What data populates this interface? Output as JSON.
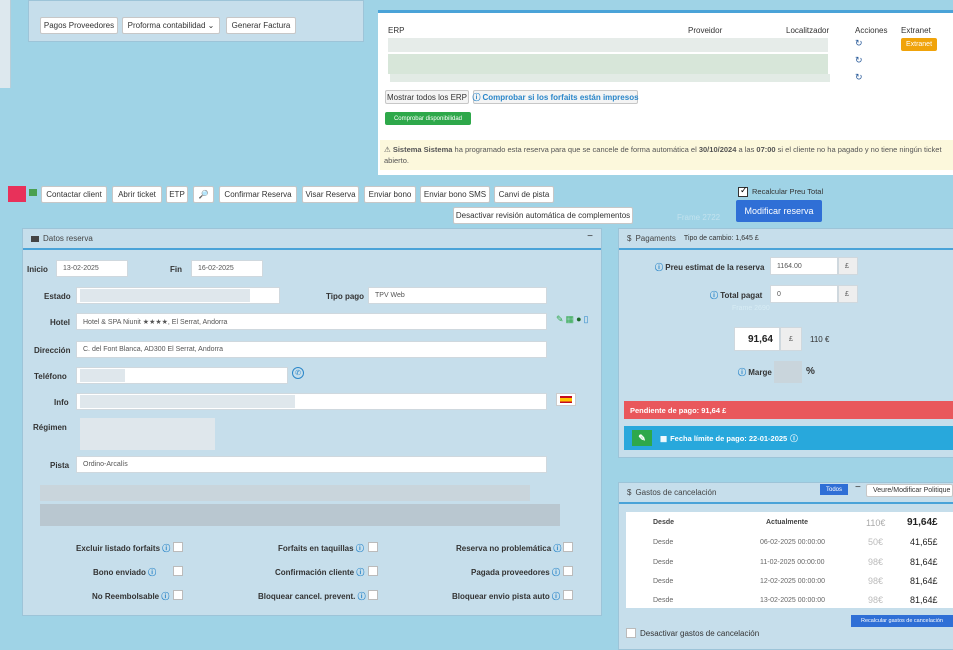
{
  "top_buttons": {
    "pagos_proveedores": "Pagos Proveedores",
    "proforma": "Proforma contabilidad ⌄",
    "generar_factura": "Generar Factura"
  },
  "erp_table": {
    "headers": {
      "erp": "ERP",
      "proveidor": "Proveidor",
      "localitzador": "Localitzador",
      "acciones": "Acciones",
      "extranet": "Extranet"
    },
    "extranet_badge": "Extranet",
    "refresh_glyph": "↻"
  },
  "erp_buttons": {
    "mostrar": "Mostrar todos los ERP",
    "comprobar_forfaits": "Comprobar si los forfaits están impresos",
    "comprobar_disp": "Comprobar disponibilidad"
  },
  "warning": {
    "icon": "⚠",
    "prefix": "Sistema Sistema",
    "t1": " ha programado esta reserva para que se cancele de forma automática el ",
    "date": "30/10/2024",
    "t2": " a las ",
    "time": "07:00",
    "t3": " si el cliente no ha pagado y no tiene ningún ticket abierto."
  },
  "recalcular": "Recalcular Preu Total",
  "modificar": "Modificar reserva",
  "actions": [
    "Contactar client",
    "Abrir ticket",
    "ETP",
    "🔎",
    "Confirmar Reserva",
    "Visar Reserva",
    "Enviar bono",
    "Enviar bono SMS",
    "Canvi de pista"
  ],
  "desactivar_revision": "Desactivar revisión automática de complementos",
  "datos": {
    "title": "Datos reserva",
    "inicio_label": "Inicio",
    "inicio": "13-02-2025",
    "fin_label": "Fin",
    "fin": "16-02-2025",
    "estado_label": "Estado",
    "tipo_pago_label": "Tipo pago",
    "tipo_pago": "TPV Web",
    "hotel_label": "Hotel",
    "hotel": "Hotel & SPA Niunit ★★★★, El Serrat, Andorra",
    "direccion_label": "Dirección",
    "direccion": "C. del Font Blanca, AD300 El Serrat, Andorra",
    "telefono_label": "Teléfono",
    "info_label": "Info",
    "regimen_label": "Régimen",
    "pista_label": "Pista",
    "pista": "Ordino-Arcalís",
    "checks": [
      {
        "label": "Excluir listado forfaits"
      },
      {
        "label": "Forfaits en taquillas"
      },
      {
        "label": "Reserva no problemática"
      },
      {
        "label": "Bono enviado"
      },
      {
        "label": "Confirmación cliente"
      },
      {
        "label": "Pagada proveedores"
      },
      {
        "label": "No Reembolsable"
      },
      {
        "label": "Bloquear cancel. prevent."
      },
      {
        "label": "Bloquear envio pista auto"
      }
    ]
  },
  "pagaments": {
    "title": "Pagaments",
    "tipo_cambio": "Tipo de cambio: 1,645 £",
    "preu_label": "Preu estimat de la reserva",
    "preu": "1164.00",
    "currency": "£",
    "total_label": "Total pagat",
    "total": "0",
    "amount": "91,64",
    "euro": "110 €",
    "marge_label": "Marge",
    "percent": "%",
    "pendiente": "Pendiente de pago: 91,64 £",
    "fecha_limite": "Fecha límite de pago: 22-01-2025"
  },
  "watermarks": {
    "frame2722": "Frame 2722",
    "frame2690": "Frame 2690"
  },
  "gastos": {
    "title": "Gastos de cancelación",
    "todos": "Todos",
    "minus": "−",
    "veure": "Veure/Modificar Politique",
    "headers": {
      "desde": "Desde",
      "actualmente": "Actualmente",
      "eur": "110€",
      "gbp": "91,64£"
    },
    "rows": [
      {
        "desde": "Desde",
        "date": "06-02-2025 00:00:00",
        "eur": "50€",
        "gbp": "41,65£"
      },
      {
        "desde": "Desde",
        "date": "11-02-2025 00:00:00",
        "eur": "98€",
        "gbp": "81,64£"
      },
      {
        "desde": "Desde",
        "date": "12-02-2025 00:00:00",
        "eur": "98€",
        "gbp": "81,64£"
      },
      {
        "desde": "Desde",
        "date": "13-02-2025 00:00:00",
        "eur": "98€",
        "gbp": "81,64£"
      }
    ],
    "recalcular_gastos": "Recalcular gastos de cancelación",
    "desactivar_gastos": "Desactivar gastos de cancelación"
  },
  "colors": {
    "primary": "#2f6fd6",
    "success": "#2ea84a",
    "warning_bg": "#fcf8dc",
    "danger": "#e9585c",
    "info": "#28a8dc",
    "extranet": "#f0a30a"
  }
}
